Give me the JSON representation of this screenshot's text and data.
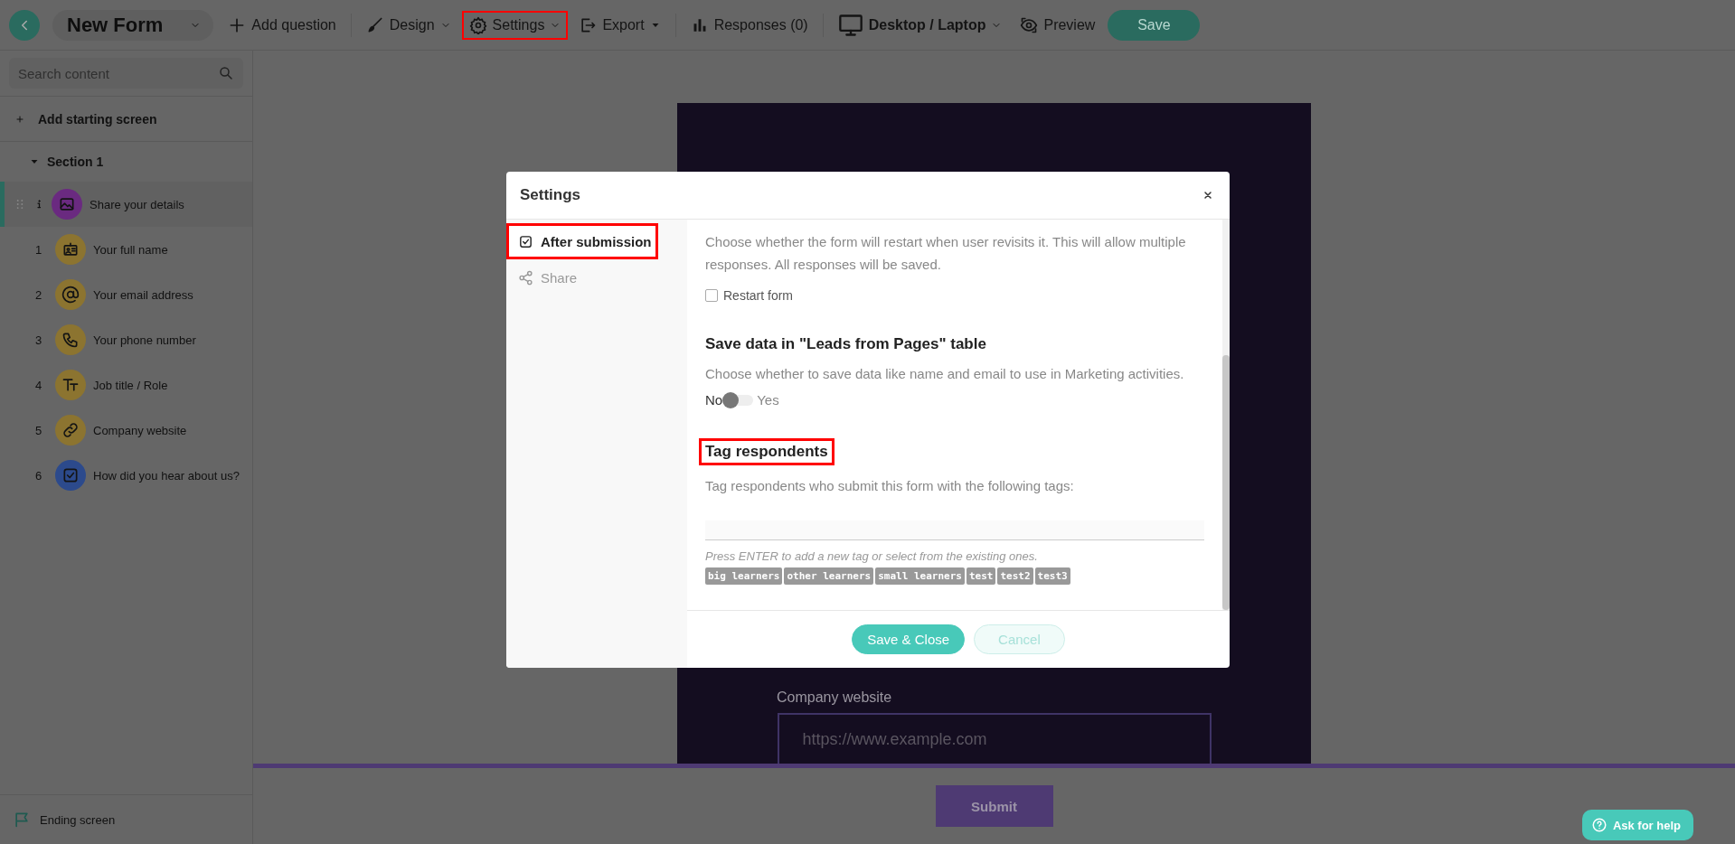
{
  "toolbar": {
    "form_title": "New Form",
    "items": [
      {
        "kind": "add",
        "label": "Add question",
        "highlighted": false
      },
      {
        "kind": "brush",
        "label": "Design",
        "highlighted": false
      },
      {
        "kind": "gear",
        "label": "Settings",
        "highlighted": true
      },
      {
        "kind": "export",
        "label": "Export",
        "highlighted": false
      },
      {
        "kind": "chart",
        "label": "Responses (0)",
        "highlighted": false
      },
      {
        "kind": "monitor",
        "label": "Desktop / Laptop",
        "highlighted": false
      },
      {
        "kind": "eye",
        "label": "Preview",
        "highlighted": false
      }
    ],
    "save_label": "Save"
  },
  "sidebar": {
    "search": {
      "placeholder": "Search content"
    },
    "add_start": "Add starting screen",
    "section": {
      "title": "Section 1",
      "expanded": true,
      "items": [
        {
          "kind": "image",
          "label": "Share your details",
          "color": "#6a2a80",
          "selected": true
        },
        {
          "kind": "badge",
          "number": "1",
          "label": "Your full name",
          "color": "#8c7430",
          "selected": false
        },
        {
          "kind": "at",
          "number": "2",
          "label": "Your email address",
          "color": "#8c7430",
          "selected": false
        },
        {
          "kind": "phone",
          "number": "3",
          "label": "Your phone number",
          "color": "#8c7430",
          "selected": false
        },
        {
          "kind": "text",
          "number": "4",
          "label": "Job title / Role",
          "color": "#8c7430",
          "selected": false
        },
        {
          "kind": "link",
          "number": "5",
          "label": "Company website",
          "color": "#8c7430",
          "selected": false
        },
        {
          "kind": "check",
          "number": "6",
          "label": "How did you hear about us?",
          "color": "#2c4a8c",
          "selected": false
        }
      ]
    },
    "ending": "Ending screen"
  },
  "preview": {
    "field_label": "Company website",
    "field_placeholder": "https://www.example.com",
    "submit": "Submit"
  },
  "help_button": "Ask for help",
  "modal": {
    "title": "Settings",
    "tabs": [
      {
        "kind": "check",
        "label": "After submission",
        "selected": true,
        "highlighted": true
      },
      {
        "kind": "share",
        "label": "Share",
        "selected": false,
        "highlighted": false
      }
    ],
    "revisit": {
      "description": "Choose whether the form will restart when user revisits it. This will allow multiple responses. All responses will be saved.",
      "checkbox": {
        "label": "Restart form",
        "checked": false
      }
    },
    "leads": {
      "heading": "Save data in \"Leads from Pages\" table",
      "description": "Choose whether to save data like name and email to use in Marketing activities.",
      "toggle": {
        "off_label": "No",
        "on_label": "Yes",
        "on": false
      }
    },
    "tags": {
      "heading": "Tag respondents",
      "highlighted": true,
      "description": "Tag respondents who submit this form with the following tags:",
      "hint": "Press ENTER to add a new tag or select from the existing ones.",
      "items": [
        "big learners",
        "other learners",
        "small learners",
        "test",
        "test2",
        "test3"
      ]
    },
    "buttons": [
      {
        "kind": "primary",
        "label": "Save & Close"
      },
      {
        "kind": "secondary",
        "label": "Cancel"
      }
    ]
  }
}
